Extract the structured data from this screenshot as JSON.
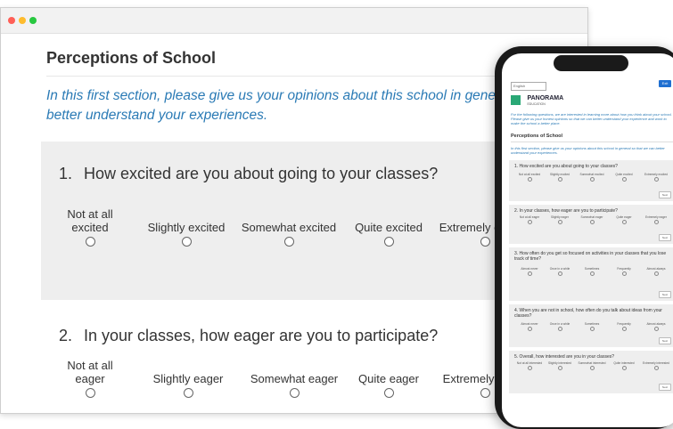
{
  "desktop": {
    "page_title": "Perceptions of School",
    "intro": "In this first section, please give us your opinions about this school in general so we can better understand your experiences.",
    "questions": [
      {
        "number": "1.",
        "text": "How excited are you about going to your classes?",
        "options": [
          "Not at all excited",
          "Slightly excited",
          "Somewhat excited",
          "Quite excited",
          "Extremely excited"
        ]
      },
      {
        "number": "2.",
        "text": "In your classes, how eager are you to participate?",
        "options": [
          "Not at all eager",
          "Slightly eager",
          "Somewhat eager",
          "Quite eager",
          "Extremely eager"
        ]
      }
    ]
  },
  "phone": {
    "language": "English",
    "exit_label": "Exit",
    "logo_name": "PANORAMA",
    "logo_sub": "EDUCATION",
    "intro": "For the following questions, we are interested in learning more about how you think about your school. Please give us your honest opinions so that we can better understand your experience and work to make the school a better place.",
    "section_title": "Perceptions of School",
    "section_intro": "In this first section, please give us your opinions about this school in general so that we can better understand your experiences.",
    "next_label": "Next",
    "questions": [
      {
        "text": "1.  How excited are you about going to your classes?",
        "options": [
          "Not at all excited",
          "Slightly excited",
          "Somewhat excited",
          "Quite excited",
          "Extremely excited"
        ]
      },
      {
        "text": "2.  In your classes, how eager are you to participate?",
        "options": [
          "Not at all eager",
          "Slightly eager",
          "Somewhat eager",
          "Quite eager",
          "Extremely eager"
        ]
      },
      {
        "text": "3.  How often do you get so focused on activities in your classes that you lose track of time?",
        "options": [
          "Almost never",
          "Once in a while",
          "Sometimes",
          "Frequently",
          "Almost always"
        ]
      },
      {
        "text": "4.  When you are not in school, how often do you talk about ideas from your classes?",
        "options": [
          "Almost never",
          "Once in a while",
          "Sometimes",
          "Frequently",
          "Almost always"
        ]
      },
      {
        "text": "5.  Overall, how interested are you in your classes?",
        "options": [
          "Not at all interested",
          "Slightly interested",
          "Somewhat interested",
          "Quite interested",
          "Extremely interested"
        ]
      }
    ]
  }
}
